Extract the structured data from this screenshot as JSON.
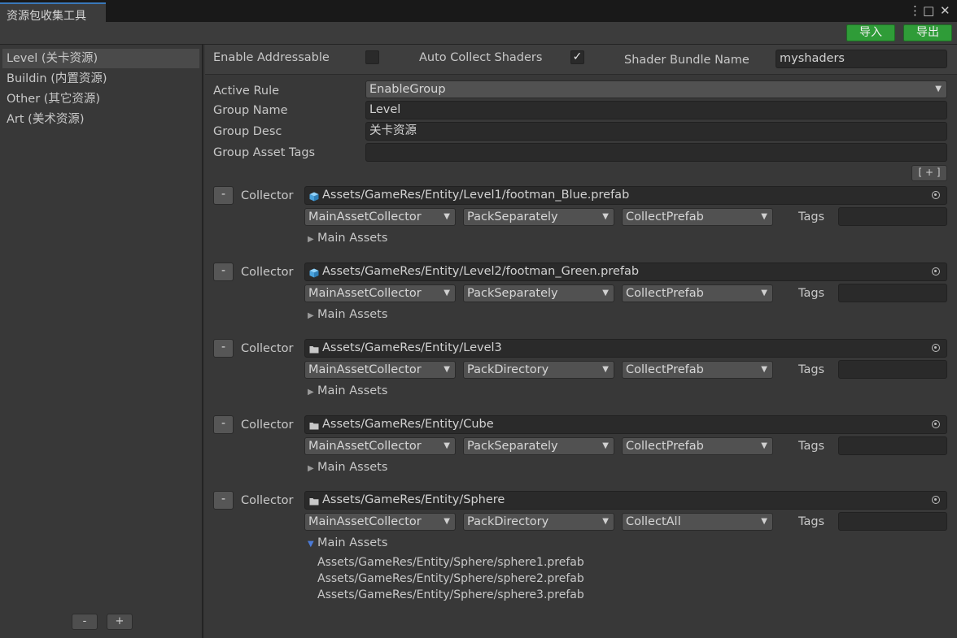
{
  "window": {
    "tab_title": "资源包收集工具",
    "menu_icon": "⋮",
    "maximize_icon": "□",
    "close_icon": "✕"
  },
  "toolbar": {
    "import_label": "导入",
    "export_label": "导出"
  },
  "sidebar": {
    "items": [
      {
        "label": "Level (关卡资源)",
        "selected": true
      },
      {
        "label": "Buildin (内置资源)",
        "selected": false
      },
      {
        "label": "Other (其它资源)",
        "selected": false
      },
      {
        "label": "Art (美术资源)",
        "selected": false
      }
    ],
    "remove_label": "-",
    "add_label": "+"
  },
  "settings": {
    "enable_addressable_label": "Enable Addressable",
    "enable_addressable_checked": false,
    "auto_collect_shaders_label": "Auto Collect Shaders",
    "auto_collect_shaders_checked": true,
    "check_mark": "✓",
    "shader_bundle_name_label": "Shader Bundle Name",
    "shader_bundle_name_value": "myshaders"
  },
  "group": {
    "active_rule_label": "Active Rule",
    "active_rule_value": "EnableGroup",
    "group_name_label": "Group Name",
    "group_name_value": "Level",
    "group_desc_label": "Group Desc",
    "group_desc_value": "关卡资源",
    "group_asset_tags_label": "Group Asset Tags",
    "group_asset_tags_value": "",
    "add_collector_label": "[ + ]"
  },
  "collectors": [
    {
      "remove_label": "-",
      "label": "Collector",
      "path": "Assets/GameRes/Entity/Level1/footman_Blue.prefab",
      "asset_type": "prefab",
      "collector_type": "MainAssetCollector",
      "pack_rule": "PackSeparately",
      "filter_rule": "CollectPrefab",
      "tags_label": "Tags",
      "tags_value": "",
      "main_assets_label": "Main Assets",
      "expanded": false,
      "main_assets": []
    },
    {
      "remove_label": "-",
      "label": "Collector",
      "path": "Assets/GameRes/Entity/Level2/footman_Green.prefab",
      "asset_type": "prefab",
      "collector_type": "MainAssetCollector",
      "pack_rule": "PackSeparately",
      "filter_rule": "CollectPrefab",
      "tags_label": "Tags",
      "tags_value": "",
      "main_assets_label": "Main Assets",
      "expanded": false,
      "main_assets": []
    },
    {
      "remove_label": "-",
      "label": "Collector",
      "path": "Assets/GameRes/Entity/Level3",
      "asset_type": "folder",
      "collector_type": "MainAssetCollector",
      "pack_rule": "PackDirectory",
      "filter_rule": "CollectPrefab",
      "tags_label": "Tags",
      "tags_value": "",
      "main_assets_label": "Main Assets",
      "expanded": false,
      "main_assets": []
    },
    {
      "remove_label": "-",
      "label": "Collector",
      "path": "Assets/GameRes/Entity/Cube",
      "asset_type": "folder",
      "collector_type": "MainAssetCollector",
      "pack_rule": "PackSeparately",
      "filter_rule": "CollectPrefab",
      "tags_label": "Tags",
      "tags_value": "",
      "main_assets_label": "Main Assets",
      "expanded": false,
      "main_assets": []
    },
    {
      "remove_label": "-",
      "label": "Collector",
      "path": "Assets/GameRes/Entity/Sphere",
      "asset_type": "folder",
      "collector_type": "MainAssetCollector",
      "pack_rule": "PackDirectory",
      "filter_rule": "CollectAll",
      "tags_label": "Tags",
      "tags_value": "",
      "main_assets_label": "Main Assets",
      "expanded": true,
      "main_assets": [
        "Assets/GameRes/Entity/Sphere/sphere1.prefab",
        "Assets/GameRes/Entity/Sphere/sphere2.prefab",
        "Assets/GameRes/Entity/Sphere/sphere3.prefab"
      ]
    }
  ],
  "colors": {
    "accent_green": "#2f9c38",
    "tab_accent": "#3a79bb",
    "prefab_icon": "#5bb0e8",
    "foldout_open": "#4b7bd8"
  }
}
